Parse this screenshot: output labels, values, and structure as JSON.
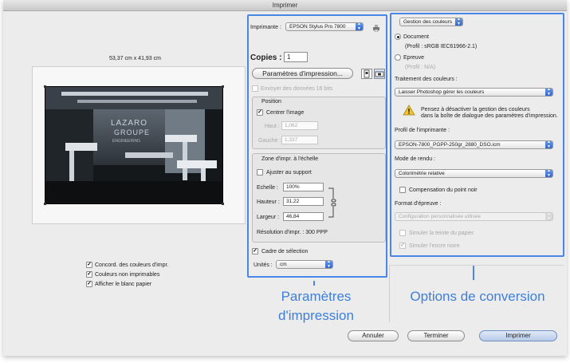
{
  "window": {
    "title": "Imprimer"
  },
  "preview": {
    "dimensions": "53,37 cm x 41,93 cm",
    "logo_lines": [
      "LAZARO",
      "GROUPE",
      "ENGINEERING"
    ]
  },
  "options": {
    "color_match": "Concord. des couleurs d'impr.",
    "gamut": "Couleurs non imprimables",
    "paper_white": "Afficher le blanc papier"
  },
  "printer": {
    "label": "Imprimante :",
    "value": "EPSON Stylus Pro 7800",
    "copies_label": "Copies :",
    "copies_value": "1",
    "settings_button": "Paramètres d'impression...",
    "send16": "Envoyer des données 16 bits"
  },
  "position": {
    "title": "Position",
    "center": "Centrer l'image",
    "top_label": "Haut :",
    "top_value": "1,062",
    "left_label": "Gauche :",
    "left_value": "1,337"
  },
  "scale": {
    "title": "Zone d'impr. à l'échelle",
    "fit": "Ajuster au support",
    "scale_label": "Echelle :",
    "scale_value": "100%",
    "height_label": "Hauteur :",
    "height_value": "31,22",
    "width_label": "Largeur :",
    "width_value": "46,84",
    "resolution": "Résolution d'impr. : 300 PPP",
    "bbox": "Cadre de sélection",
    "units_label": "Unités :",
    "units_value": "cm"
  },
  "color": {
    "mode": "Gestion des couleurs",
    "document": "Document",
    "document_profile": "(Profil : sRGB IEC61966-2.1)",
    "proof": "Epreuve",
    "proof_profile": "(Profil : N/A)",
    "handling_label": "Traitement des couleurs :",
    "handling_value": "Laisser Photoshop gérer les couleurs",
    "warning_lines": [
      "Pensez à désactiver la gestion des couleurs",
      "dans la boîte de dialogue des paramètres d'impression."
    ],
    "profile_label": "Profil de l'imprimante :",
    "profile_value": "EPSON-7800_PGPP-250gr_2880_DSO.icm",
    "intent_label": "Mode de rendu :",
    "intent_value": "Colorimétrie relative",
    "bpc": "Compensation du point noir",
    "proof_label": "Format d'épreuve :",
    "proof_value": "Configuration personnalisée utilisée",
    "simulate_paper": "Simuler la teinte du papier",
    "simulate_black": "Simuler l'encre noire"
  },
  "buttons": {
    "cancel": "Annuler",
    "done": "Terminer",
    "print": "Imprimer"
  },
  "callouts": {
    "print_settings_lines": [
      "Paramètres",
      "d'impression"
    ],
    "conversion": "Options de conversion"
  },
  "colors": {
    "accent": "#4a86e8",
    "callout_text": "#3e7fd8"
  }
}
